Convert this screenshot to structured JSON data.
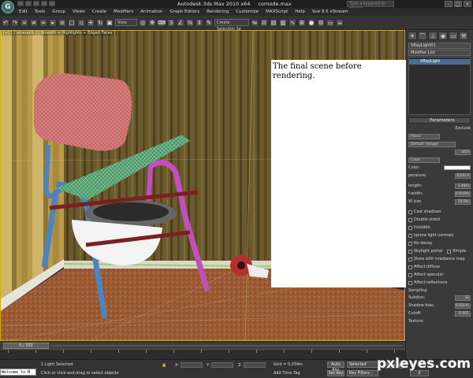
{
  "window": {
    "app_name": "Autodesk 3ds Max  2010 x64",
    "file_name": "comode.max",
    "search_placeholder": "Type a keyword or phrase",
    "logo_glyph": "G"
  },
  "menu": [
    "Edit",
    "Tools",
    "Group",
    "Views",
    "Create",
    "Modifiers",
    "Animation",
    "Graph Editors",
    "Rendering",
    "Customize",
    "MAXScript",
    "Help",
    "Vue 9.5 xStream"
  ],
  "toolbar": {
    "view_selector": "View",
    "selection_set": "Create Selection Se"
  },
  "viewport": {
    "label": "[+] [ Camera01 ] [ Smooth + Highlights + Edged Faces ]"
  },
  "note": {
    "text": "The final scene before rendering."
  },
  "command_panel": {
    "object_name": "VRayLight01",
    "modifier_list": "Modifier List",
    "stack_item": "VRayLight",
    "rollout_title": "Parameters",
    "exclude_label": "Exclude",
    "type_value": "Plane",
    "units_value": "Default (image)",
    "multiplier_value": "30.0",
    "mode_value": "Color",
    "color_label": "Color:",
    "temperature_label": "perature:",
    "temperature_value": "6500.0",
    "half_length_label": "length:",
    "half_length_value": "1.46m",
    "half_width_label": "f-width:",
    "half_width_value": "0.659m",
    "w_size_label": "W size",
    "w_size_value": "10.0m",
    "options": [
      "Cast shadows",
      "Double-sided",
      "Invisible",
      "Ignore light normals",
      "No decay",
      "Skylight portal",
      "Store with irradiance map",
      "Affect diffuse",
      "Affect specular",
      "Affect reflections"
    ],
    "simple_label": "Simple",
    "sampling_title": "Sampling",
    "subdivs_label": "Subdivs:",
    "subdivs_value": "32",
    "shadow_bias_label": "Shadow bias:",
    "shadow_bias_value": "0.02cm",
    "cutoff_label": "Cutoff:",
    "cutoff_value": "0.001",
    "texture_label": "Texture:"
  },
  "timeline": {
    "frame_display": "0 / 100"
  },
  "status": {
    "welcome": "Welcome to M",
    "selection": "1 Light Selected",
    "prompt": "Click or click-and-drag to select objects",
    "x_label": "X:",
    "y_label": "Y:",
    "z_label": "Z:",
    "grid": "Grid = 0.254m",
    "add_time_tag": "Add Time Tag",
    "auto_key": "Auto Key",
    "set_key": "Set Key",
    "selected_filter": "Selected",
    "key_filters": "Key Filters...",
    "frame": "0"
  },
  "watermark": "pxleyes.com"
}
